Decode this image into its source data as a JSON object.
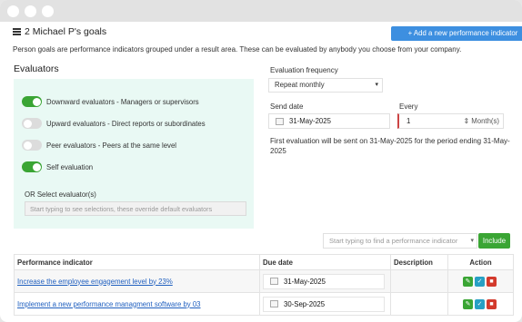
{
  "header": {
    "title": "2 Michael P's goals",
    "add_button": "+ Add a new performance indicator",
    "intro": "Person goals are performance indicators grouped under a result area. These can be evaluated by anybody you choose from your company."
  },
  "evaluators": {
    "title": "Evaluators",
    "toggles": [
      {
        "label": "Downward evaluators - Managers or supervisors",
        "on": true
      },
      {
        "label": "Upward evaluators - Direct reports or subordinates",
        "on": false
      },
      {
        "label": "Peer evaluators - Peers at the same level",
        "on": false
      },
      {
        "label": "Self evaluation",
        "on": true
      }
    ],
    "or_label": "OR Select evaluator(s)",
    "select_placeholder": "Start typing to see selections, these override default evaluators"
  },
  "frequency": {
    "label": "Evaluation frequency",
    "value": "Repeat monthly",
    "send_label": "Send date",
    "send_value": "31-May-2025",
    "every_label": "Every",
    "every_value": "1",
    "every_unit": "Month(s)",
    "first_eval": "First evaluation will be sent on 31-May-2025 for the period ending 31-May-2025"
  },
  "search": {
    "placeholder": "Start typing to find a performance indicator",
    "include_button": "Include"
  },
  "table": {
    "headers": [
      "Performance indicator",
      "Due date",
      "Description",
      "Action"
    ],
    "rows": [
      {
        "indicator": "Increase the employee engagement level by 23%",
        "due": "31-May-2025",
        "description": ""
      },
      {
        "indicator": "Implement a new performance managment software by 03",
        "due": "30-Sep-2025",
        "description": ""
      }
    ]
  },
  "colors": {
    "accent_blue": "#3d8fe0",
    "success_green": "#3aa534",
    "danger_red": "#d33a2c",
    "info_teal": "#27a0c4",
    "panel_mint": "#e9f9f4"
  },
  "icons": [
    "calendar-icon",
    "edit-icon",
    "check-icon",
    "delete-icon",
    "goals-list-icon"
  ]
}
